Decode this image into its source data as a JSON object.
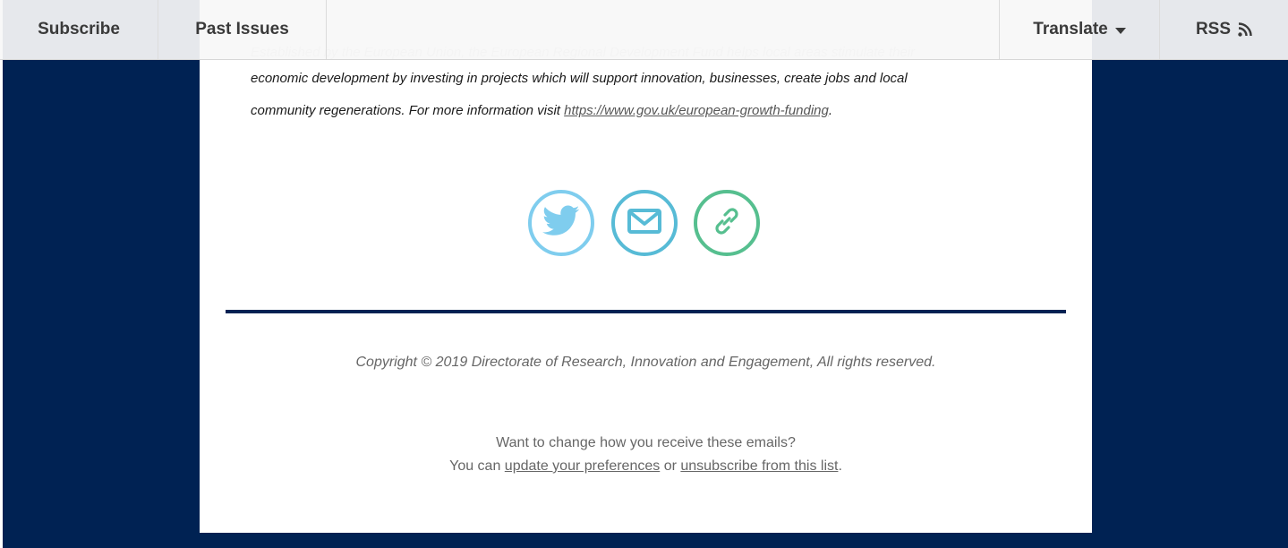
{
  "topbar": {
    "subscribe_label": "Subscribe",
    "past_issues_label": "Past Issues",
    "translate_label": "Translate",
    "rss_label": "RSS"
  },
  "content": {
    "paragraph_line1": "Established by the European Union, the European Regional Development Fund helps local areas stimulate their",
    "paragraph_line2": "economic development by investing in projects which will support innovation, businesses, create jobs and local",
    "paragraph_line3_prefix": "community regenerations.  For more information visit ",
    "link_text": "https://www.gov.uk/european-growth-funding",
    "paragraph_line3_suffix": "."
  },
  "social": {
    "items": [
      {
        "icon": "twitter-icon",
        "color": "#7fcdee"
      },
      {
        "icon": "email-icon",
        "color": "#57bbd6"
      },
      {
        "icon": "link-icon",
        "color": "#56bf8f"
      }
    ]
  },
  "footer": {
    "copyright": "Copyright © 2019 Directorate of Research, Innovation and Engagement, All rights reserved.",
    "change_prompt": "Want to change how you receive these emails?",
    "you_can": "You can ",
    "update_link": "update your preferences",
    "or_text": " or ",
    "unsubscribe_link": "unsubscribe from this list",
    "end_period": "."
  },
  "colors": {
    "navy": "#002253",
    "card": "#ffffff",
    "topbar_bg": "#f7f7f7"
  }
}
